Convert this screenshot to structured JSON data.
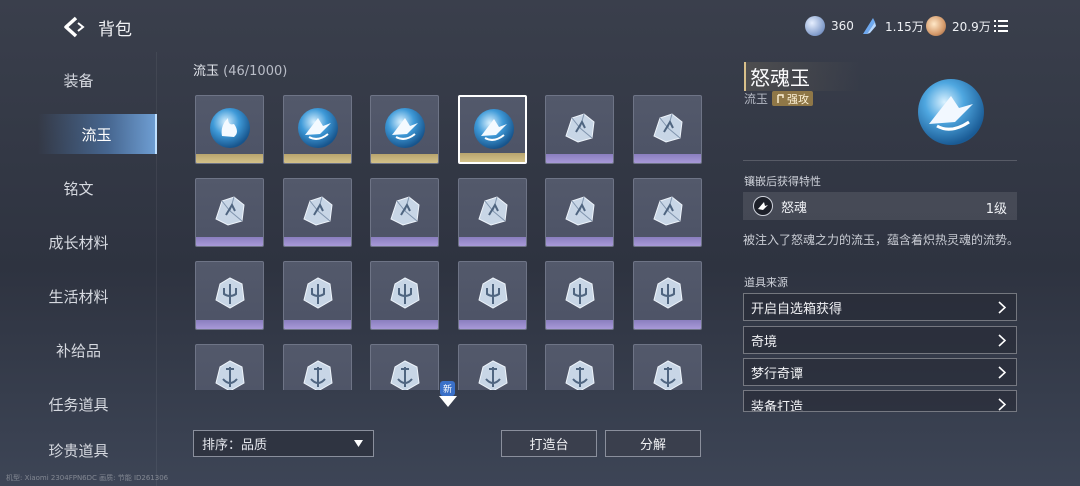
{
  "header": {
    "title": "背包",
    "currencies": [
      {
        "icon": "silver-coin-icon",
        "value": "360"
      },
      {
        "icon": "crystal-feather-icon",
        "value": "1.15万"
      },
      {
        "icon": "gold-coin-icon",
        "value": "20.9万"
      }
    ]
  },
  "sidebar": {
    "items": [
      {
        "label": "装备"
      },
      {
        "label": "流玉"
      },
      {
        "label": "铭文"
      },
      {
        "label": "成长材料"
      },
      {
        "label": "生活材料"
      },
      {
        "label": "补给品"
      },
      {
        "label": "任务道具"
      },
      {
        "label": "珍贵道具"
      }
    ],
    "active_index": 1
  },
  "inventory": {
    "category": "流玉",
    "count": "(46/1000)",
    "new_badge": "新",
    "items": [
      {
        "rarity": "gold",
        "icon": "flame-orb-icon"
      },
      {
        "rarity": "gold",
        "icon": "wing-orb-icon"
      },
      {
        "rarity": "gold",
        "icon": "wing-orb-icon"
      },
      {
        "rarity": "gold",
        "icon": "wing-orb-icon",
        "selected": true
      },
      {
        "rarity": "purple",
        "icon": "crystal-shard-icon"
      },
      {
        "rarity": "purple",
        "icon": "crystal-shard-icon"
      },
      {
        "rarity": "purple",
        "icon": "crystal-shard-icon"
      },
      {
        "rarity": "purple",
        "icon": "crystal-shard-icon"
      },
      {
        "rarity": "purple",
        "icon": "crystal-shard-icon"
      },
      {
        "rarity": "purple",
        "icon": "crystal-shard-icon"
      },
      {
        "rarity": "purple",
        "icon": "crystal-shard-icon"
      },
      {
        "rarity": "purple",
        "icon": "crystal-shard-icon"
      },
      {
        "rarity": "purple",
        "icon": "crystal-trident-icon"
      },
      {
        "rarity": "purple",
        "icon": "crystal-trident-icon"
      },
      {
        "rarity": "purple",
        "icon": "crystal-trident-icon"
      },
      {
        "rarity": "purple",
        "icon": "crystal-trident-icon"
      },
      {
        "rarity": "purple",
        "icon": "crystal-trident-icon"
      },
      {
        "rarity": "purple",
        "icon": "crystal-trident-icon"
      },
      {
        "rarity": "purple",
        "icon": "crystal-anchor-icon"
      },
      {
        "rarity": "purple",
        "icon": "crystal-anchor-icon"
      },
      {
        "rarity": "purple",
        "icon": "crystal-anchor-icon"
      },
      {
        "rarity": "purple",
        "icon": "crystal-anchor-icon"
      },
      {
        "rarity": "purple",
        "icon": "crystal-anchor-icon"
      },
      {
        "rarity": "purple",
        "icon": "crystal-anchor-icon"
      }
    ]
  },
  "bottom": {
    "sort_label": "排序：品质",
    "forge_label": "打造台",
    "decompose_label": "分解"
  },
  "detail": {
    "name": "怒魂玉",
    "type": "流玉",
    "tag": "强攻",
    "trait_heading": "镶嵌后获得特性",
    "trait_name": "怒魂",
    "trait_level": "1级",
    "description": "被注入了怒魂之力的流玉，蕴含着炽热灵魂的流势。",
    "source_heading": "道具来源",
    "sources": [
      "开启自选箱获得",
      "奇境",
      "梦行奇谭",
      "装备打造"
    ]
  },
  "footer": "机型: Xiaomi 2304FPN6DC 画质: 节能 ID261306",
  "colors": {
    "gold_rarity": "#c9b67c",
    "purple_rarity": "#9a8dcf",
    "active_tab": "#6fa6e0"
  }
}
